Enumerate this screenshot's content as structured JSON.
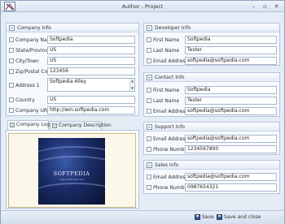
{
  "window": {
    "title": "Author - Project"
  },
  "company_info": {
    "header": "Company Info",
    "fields": [
      {
        "label": "Company Name",
        "value": "Softpedia"
      },
      {
        "label": "State/Province",
        "value": "US"
      },
      {
        "label": "City/Town",
        "value": "US"
      },
      {
        "label": "Zip/Postal Code",
        "value": "123456"
      },
      {
        "label": "Address 1",
        "value": "Softpedia Alley"
      },
      {
        "label": "Country",
        "value": "US"
      },
      {
        "label": "Company URL",
        "value": "http://win.softpedia.com"
      }
    ]
  },
  "tabs": [
    {
      "label": "Company Logo"
    },
    {
      "label": "Company Description"
    }
  ],
  "logo": {
    "text": "SOFTPEDIA",
    "subtext": "www.softpedia.com"
  },
  "developer_info": {
    "header": "Developer Info",
    "fields": [
      {
        "label": "First Name",
        "value": "Softpedia"
      },
      {
        "label": "Last Name",
        "value": "Tester"
      },
      {
        "label": "Email Address",
        "value": "softpedia@softpedia.com"
      }
    ]
  },
  "contact_info": {
    "header": "Contact Info",
    "fields": [
      {
        "label": "First Name",
        "value": "Softpedia"
      },
      {
        "label": "Last Name",
        "value": "Tester"
      },
      {
        "label": "Email Address",
        "value": "softpedia@softpedia.com"
      }
    ]
  },
  "support_info": {
    "header": "Support Info",
    "fields": [
      {
        "label": "Email Address",
        "value": "softpedia@softpedia.com"
      },
      {
        "label": "Phone Number",
        "value": "1234567890"
      }
    ]
  },
  "sales_info": {
    "header": "Sales Info",
    "fields": [
      {
        "label": "Email Address",
        "value": "softpedia@softpedia.com"
      },
      {
        "label": "Phone Number",
        "value": "0987654321"
      }
    ]
  },
  "statusbar": {
    "save_label": "Save",
    "save_close_label": "Save and close"
  }
}
